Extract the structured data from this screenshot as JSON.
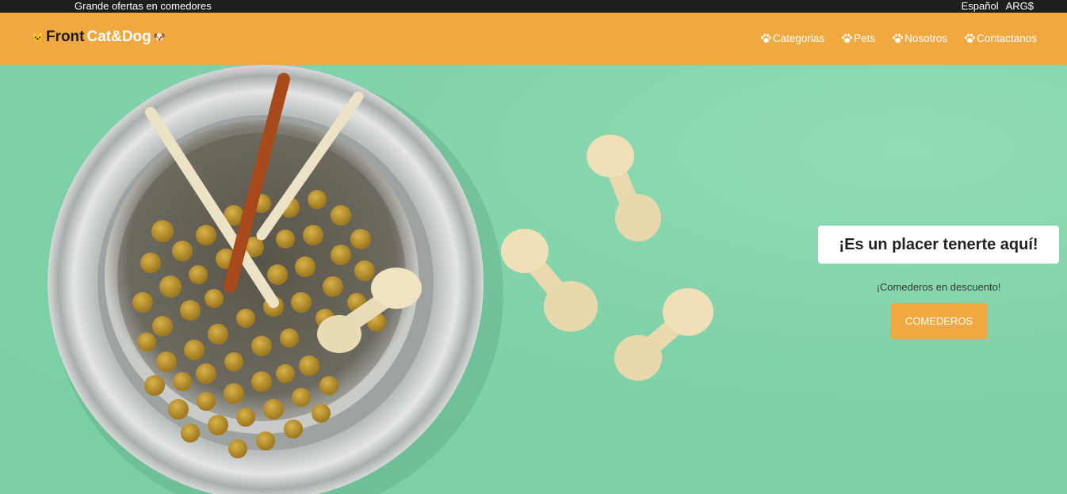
{
  "topbar": {
    "promo": "Grande ofertas en comedores",
    "language": "Español",
    "currency": "ARG$"
  },
  "brand": {
    "front": "Front",
    "catdog": "Cat&Dog",
    "left_icon": "cat-face-icon",
    "right_icon": "dog-face-icon"
  },
  "nav": {
    "items": [
      {
        "label": "Categorias",
        "icon": "paw-icon"
      },
      {
        "label": "Pets",
        "icon": "paw-icon"
      },
      {
        "label": "Nosotros",
        "icon": "paw-icon"
      },
      {
        "label": "Contactanos",
        "icon": "paw-icon"
      }
    ]
  },
  "hero": {
    "title": "¡Es un placer tenerte aquí!",
    "subtitle": "¡Comederos en descuento!",
    "button": "COMEDEROS"
  },
  "colors": {
    "topbar": "#1e1e1e",
    "accent": "#efa940",
    "hero_bg": "#7fd3aa"
  }
}
